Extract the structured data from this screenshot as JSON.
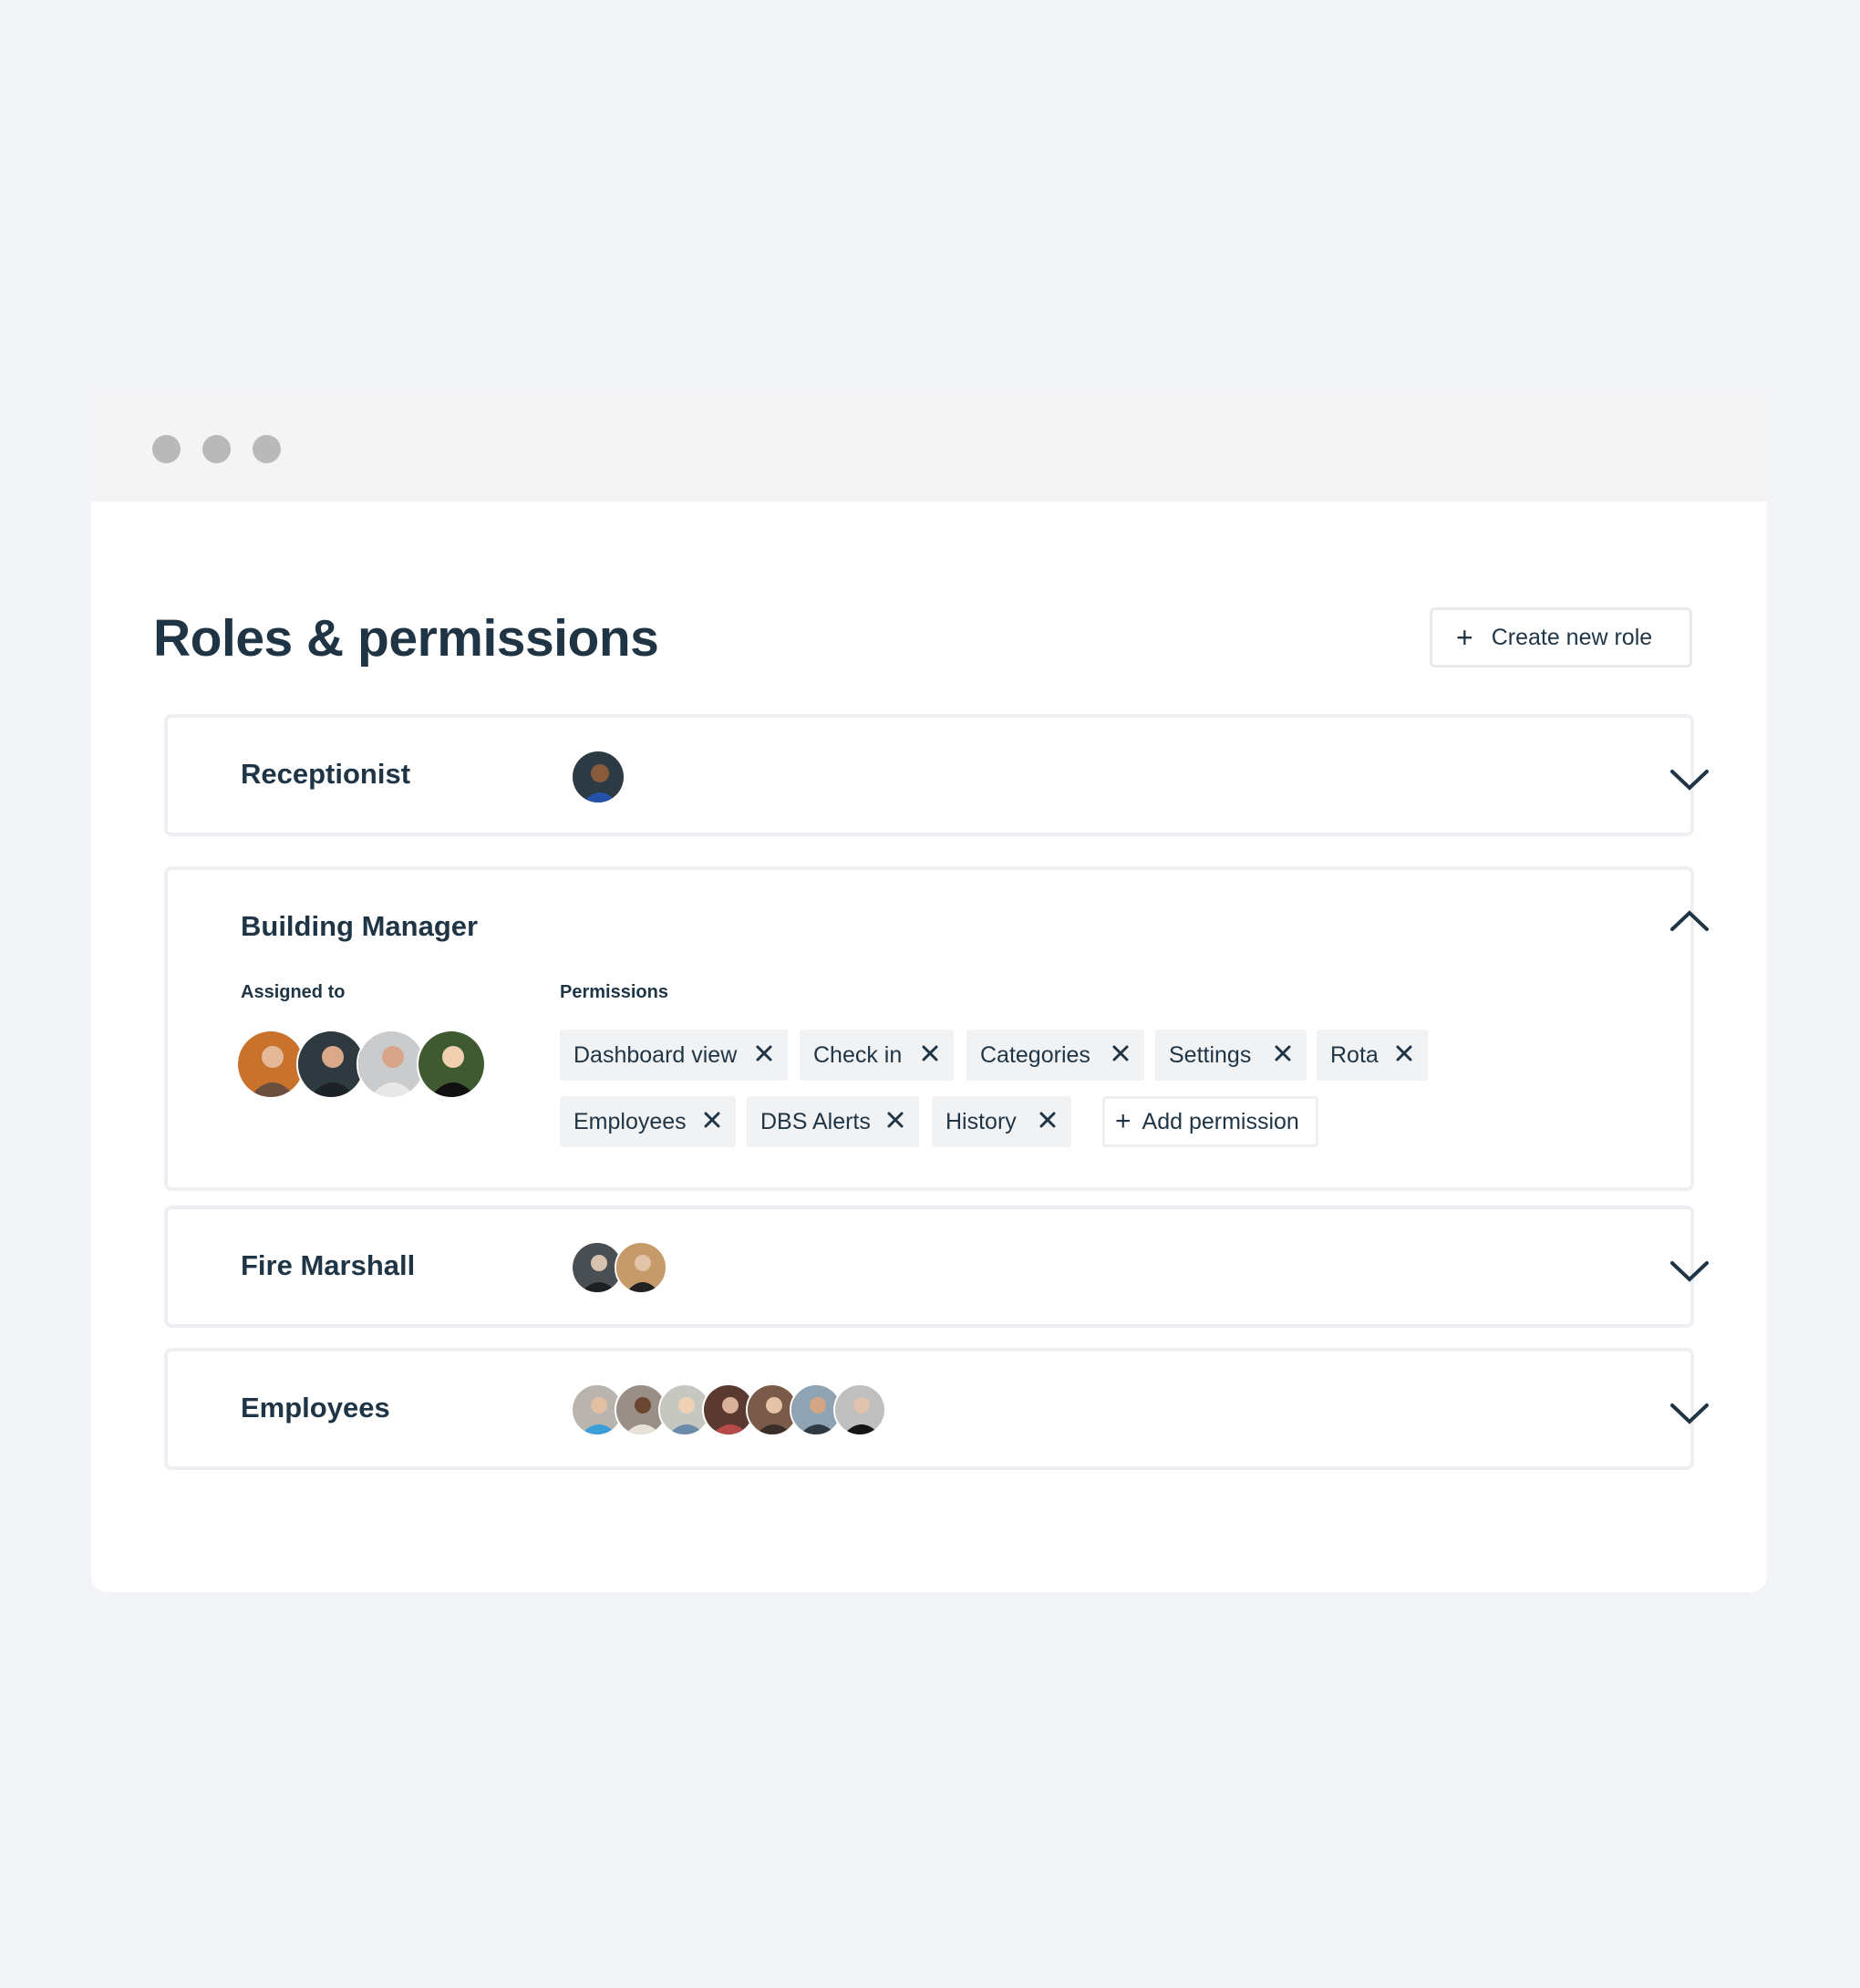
{
  "window": {
    "controls": [
      "close",
      "minimize",
      "maximize"
    ]
  },
  "page": {
    "title": "Roles & permissions"
  },
  "toolbar": {
    "create_role_label": "Create new role",
    "create_role_icon": "plus-icon"
  },
  "roles": [
    {
      "name": "Receptionist",
      "expanded": false,
      "member_count": 1
    },
    {
      "name": "Building Manager",
      "expanded": true,
      "member_count": 4,
      "assigned_label": "Assigned to",
      "permissions_label": "Permissions",
      "permissions": [
        "Dashboard view",
        "Check in",
        "Categories",
        "Settings",
        "Rota",
        "Employees",
        "DBS Alerts",
        "History"
      ],
      "add_permission_label": "Add permission"
    },
    {
      "name": "Fire Marshall",
      "expanded": false,
      "member_count": 2
    },
    {
      "name": "Employees",
      "expanded": false,
      "member_count": 7
    }
  ],
  "colors": {
    "text": "#1f3545",
    "background": "#f3f4f7",
    "card_border": "#edeff2",
    "chip_bg": "#f1f2f4"
  }
}
